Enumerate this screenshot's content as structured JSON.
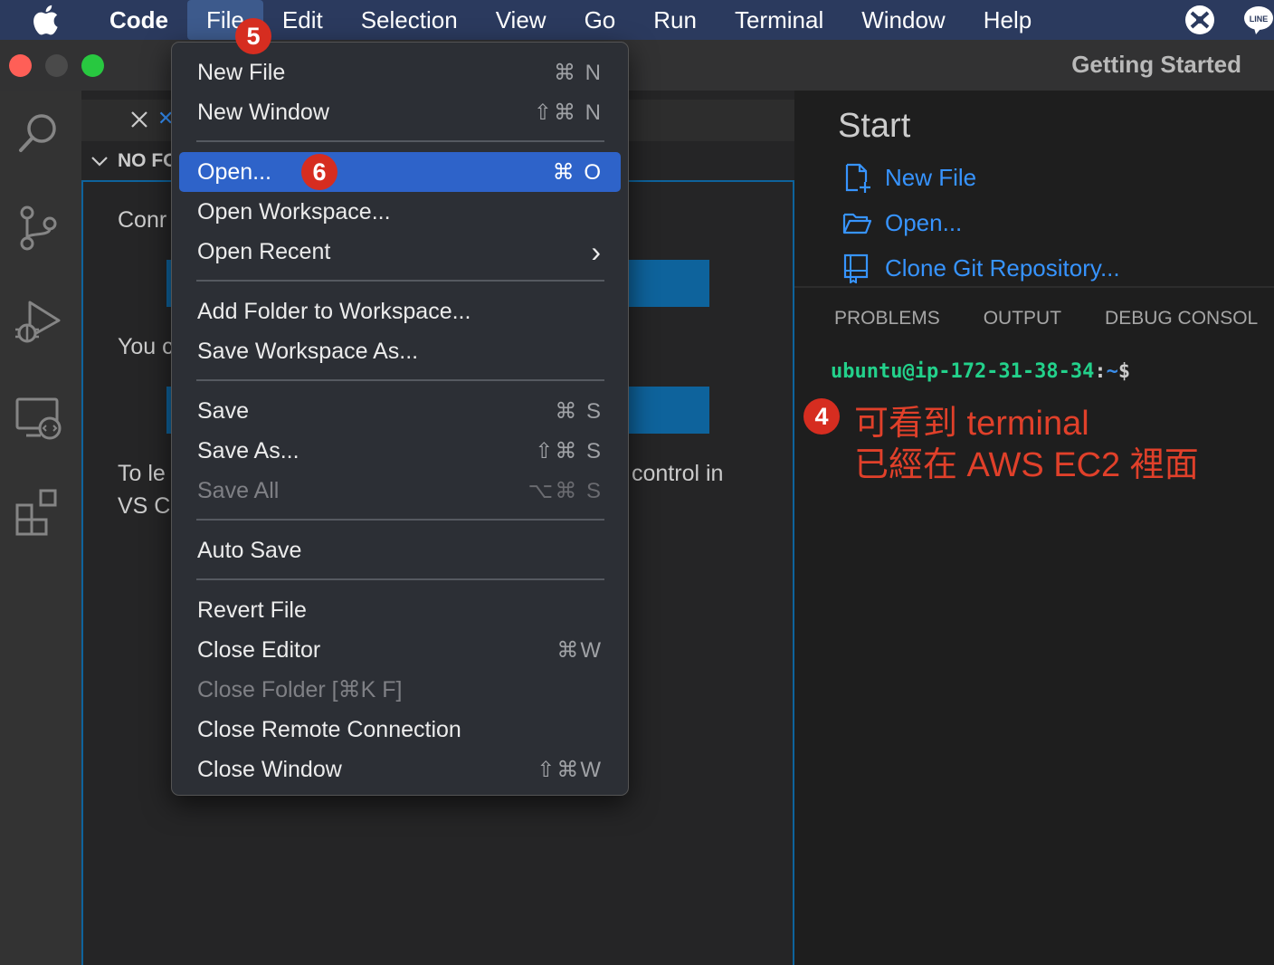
{
  "menubar": {
    "app": "Code",
    "items": [
      "File",
      "Edit",
      "Selection",
      "View",
      "Go",
      "Run",
      "Terminal",
      "Window",
      "Help"
    ],
    "active": "File"
  },
  "window": {
    "title": "Getting Started",
    "traffic_colors": {
      "close": "#ff5f57",
      "minimize": "#4a4a4a",
      "zoom": "#28c840"
    }
  },
  "editor_left": {
    "section_header": "NO FO",
    "texts": {
      "line1": "Conr",
      "line2": "You c",
      "line3a": "To le",
      "line3b": "control in",
      "line4": "VS C"
    }
  },
  "file_menu": {
    "items": [
      {
        "label": "New File",
        "shortcut": "⌘ N"
      },
      {
        "label": "New Window",
        "shortcut": "⇧⌘ N"
      },
      {
        "label": "Open...",
        "shortcut": "⌘ O"
      },
      {
        "label": "Open Workspace...",
        "shortcut": ""
      },
      {
        "label": "Open Recent",
        "shortcut": "›"
      },
      {
        "label": "Add Folder to Workspace...",
        "shortcut": ""
      },
      {
        "label": "Save Workspace As...",
        "shortcut": ""
      },
      {
        "label": "Save",
        "shortcut": "⌘ S"
      },
      {
        "label": "Save As...",
        "shortcut": "⇧⌘ S"
      },
      {
        "label": "Save All",
        "shortcut": "⌥⌘ S"
      },
      {
        "label": "Auto Save",
        "shortcut": ""
      },
      {
        "label": "Revert File",
        "shortcut": ""
      },
      {
        "label": "Close Editor",
        "shortcut": "⌘W"
      },
      {
        "label": "Close Folder [⌘K F]",
        "shortcut": ""
      },
      {
        "label": "Close Remote Connection",
        "shortcut": ""
      },
      {
        "label": "Close Window",
        "shortcut": "⇧⌘W"
      }
    ]
  },
  "start": {
    "title": "Start",
    "links": [
      "New File",
      "Open...",
      "Clone Git Repository..."
    ]
  },
  "panel": {
    "tabs": [
      "PROBLEMS",
      "OUTPUT",
      "DEBUG CONSOL"
    ],
    "terminal": {
      "user_host": "ubuntu@ip-172-31-38-34",
      "colon": ":",
      "path": "~",
      "prompt": "$"
    }
  },
  "annotations": {
    "badge4": "4",
    "badge5": "5",
    "badge6": "6",
    "note_line1": "可看到 terminal",
    "note_line2": "已經在 AWS EC2 裡面",
    "color": "#e0402a"
  },
  "colors": {
    "accent_blue": "#3794ff",
    "highlight": "#2e63c9",
    "button_blue": "#0e639c",
    "terminal_green": "#23d18b"
  }
}
